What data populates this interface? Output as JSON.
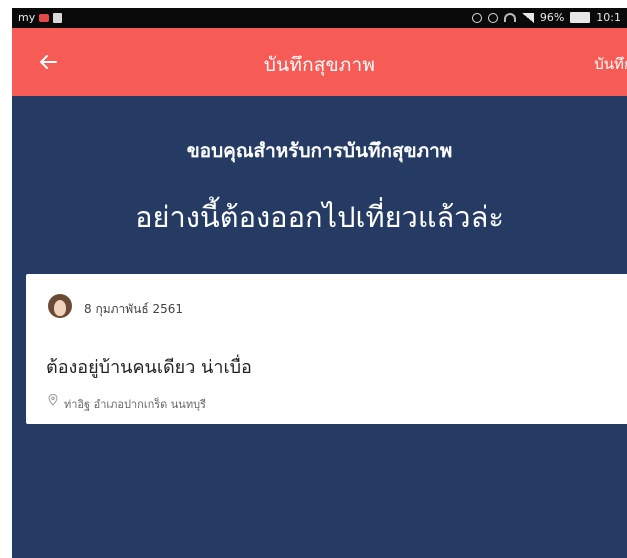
{
  "status_bar": {
    "carrier": "my",
    "battery": "96%",
    "time": "10:1"
  },
  "app_bar": {
    "title": "บันทึกสุขภาพ",
    "action_label": "บันทึก"
  },
  "message": {
    "headline": "ขอบคุณสำหรับการบันทึกสุขภาพ",
    "subline": "อย่างนี้ต้องออกไปเที่ยวแล้วล่ะ"
  },
  "entry": {
    "date": "8 กุมภาพันธ์ 2561",
    "text": "ต้องอยู่บ้านคนเดียว น่าเบื่อ",
    "location": "ท่าอิฐ อำเภอปากเกร็ด นนทบุรี"
  },
  "colors": {
    "app_bar": "#f75b55",
    "background": "#253b63",
    "card": "#ffffff"
  },
  "icons": [
    "back-arrow-icon",
    "avatar",
    "location-pin-icon",
    "wifi-icon",
    "signal-icon",
    "battery-icon"
  ]
}
